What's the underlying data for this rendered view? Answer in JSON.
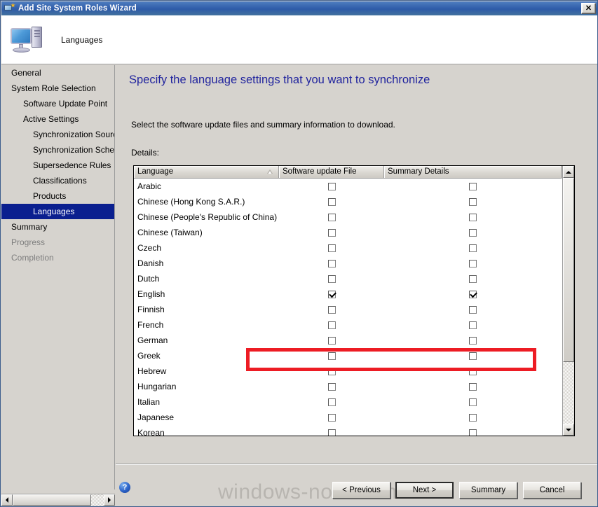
{
  "window": {
    "title": "Add Site System Roles Wizard",
    "close_label": "✕",
    "header_title": "Languages"
  },
  "sidebar": {
    "items": [
      {
        "label": "General",
        "indent": 0,
        "state": "normal"
      },
      {
        "label": "System Role Selection",
        "indent": 0,
        "state": "normal"
      },
      {
        "label": "Software Update Point",
        "indent": 1,
        "state": "normal"
      },
      {
        "label": "Active Settings",
        "indent": 1,
        "state": "normal"
      },
      {
        "label": "Synchronization Source",
        "indent": 2,
        "state": "normal"
      },
      {
        "label": "Synchronization Schedule",
        "indent": 2,
        "state": "normal"
      },
      {
        "label": "Supersedence Rules",
        "indent": 2,
        "state": "normal"
      },
      {
        "label": "Classifications",
        "indent": 2,
        "state": "normal"
      },
      {
        "label": "Products",
        "indent": 2,
        "state": "normal"
      },
      {
        "label": "Languages",
        "indent": 2,
        "state": "selected"
      },
      {
        "label": "Summary",
        "indent": 0,
        "state": "normal"
      },
      {
        "label": "Progress",
        "indent": 0,
        "state": "disabled"
      },
      {
        "label": "Completion",
        "indent": 0,
        "state": "disabled"
      }
    ]
  },
  "content": {
    "heading": "Specify the language settings that you want to synchronize",
    "intro": "Select the software update files and summary information to download.",
    "details_label": "Details:",
    "columns": [
      {
        "label": "Language",
        "sorted": "ascending"
      },
      {
        "label": "Software update File",
        "sorted": ""
      },
      {
        "label": "Summary Details",
        "sorted": ""
      }
    ],
    "rows": [
      {
        "language": "Arabic",
        "software_update_file": false,
        "summary_details": false
      },
      {
        "language": "Chinese (Hong Kong S.A.R.)",
        "software_update_file": false,
        "summary_details": false
      },
      {
        "language": "Chinese (People's Republic of China)",
        "software_update_file": false,
        "summary_details": false
      },
      {
        "language": "Chinese (Taiwan)",
        "software_update_file": false,
        "summary_details": false
      },
      {
        "language": "Czech",
        "software_update_file": false,
        "summary_details": false
      },
      {
        "language": "Danish",
        "software_update_file": false,
        "summary_details": false
      },
      {
        "language": "Dutch",
        "software_update_file": false,
        "summary_details": false
      },
      {
        "language": "English",
        "software_update_file": true,
        "summary_details": true,
        "highlighted": true
      },
      {
        "language": "Finnish",
        "software_update_file": false,
        "summary_details": false
      },
      {
        "language": "French",
        "software_update_file": false,
        "summary_details": false
      },
      {
        "language": "German",
        "software_update_file": false,
        "summary_details": false
      },
      {
        "language": "Greek",
        "software_update_file": false,
        "summary_details": false
      },
      {
        "language": "Hebrew",
        "software_update_file": false,
        "summary_details": false
      },
      {
        "language": "Hungarian",
        "software_update_file": false,
        "summary_details": false
      },
      {
        "language": "Italian",
        "software_update_file": false,
        "summary_details": false
      },
      {
        "language": "Japanese",
        "software_update_file": false,
        "summary_details": false
      },
      {
        "language": "Korean",
        "software_update_file": false,
        "summary_details": false
      }
    ],
    "annotation_color": "#ed1c24"
  },
  "footer": {
    "help_label": "?",
    "buttons": [
      {
        "id": "previous",
        "label": "< Previous",
        "default": false
      },
      {
        "id": "next",
        "label": "Next >",
        "default": true
      },
      {
        "id": "summary",
        "label": "Summary",
        "default": false
      },
      {
        "id": "cancel",
        "label": "Cancel",
        "default": false
      }
    ],
    "watermark": "windows-noob.com"
  }
}
